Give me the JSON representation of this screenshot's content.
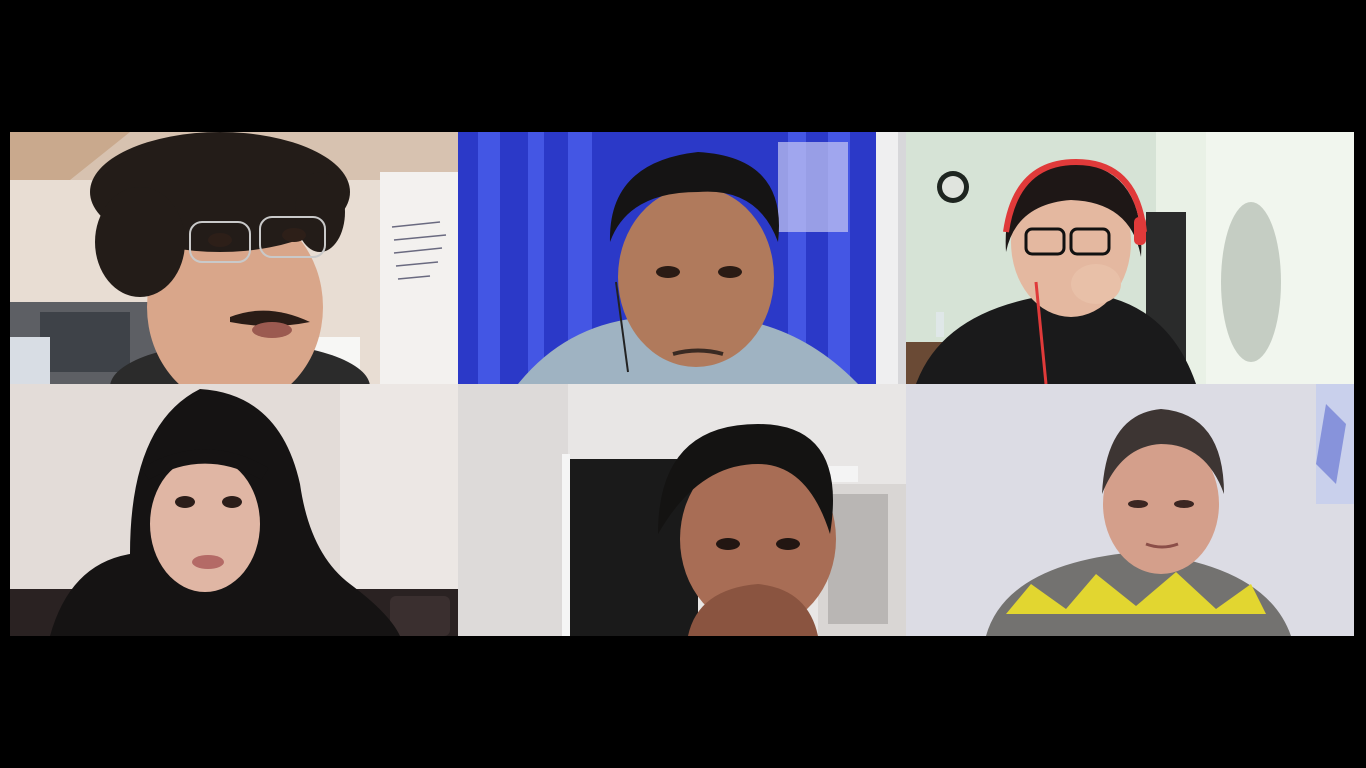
{
  "window": {
    "background": "#000000"
  },
  "gallery": {
    "layout": "3x2",
    "tiles": [
      {
        "id": 1,
        "background": "#e6dcd4",
        "camera": "on"
      },
      {
        "id": 2,
        "background": "#3a4fd6",
        "camera": "on"
      },
      {
        "id": 3,
        "background": "#d8e6d8",
        "camera": "on"
      },
      {
        "id": 4,
        "background": "#e2dad6",
        "camera": "on"
      },
      {
        "id": 5,
        "background": "#e8e4e2",
        "camera": "on"
      },
      {
        "id": 6,
        "background": "#dfdfe6",
        "camera": "on"
      }
    ]
  }
}
